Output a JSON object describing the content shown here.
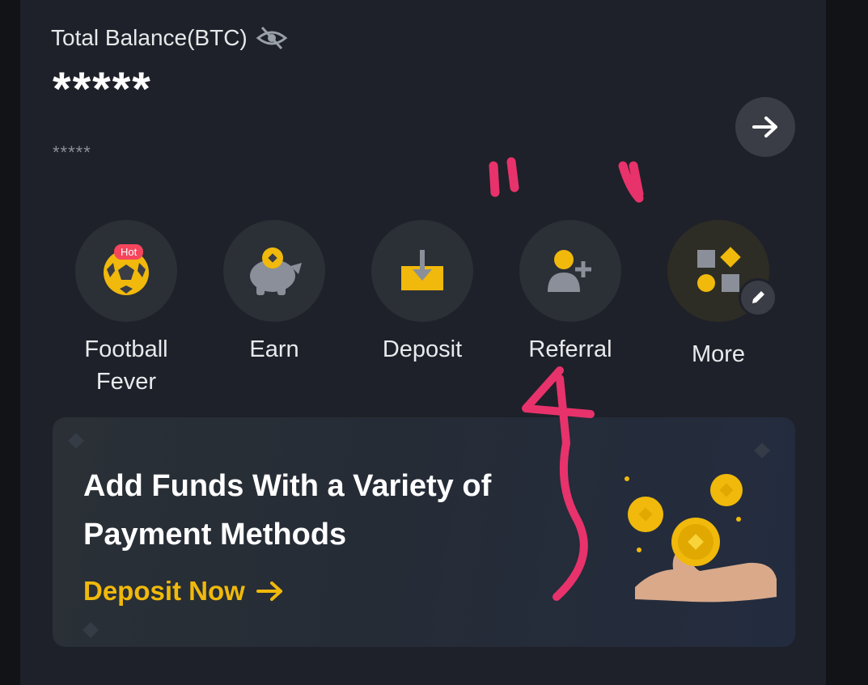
{
  "balance": {
    "label": "Total Balance(BTC)",
    "value": "*****",
    "sub_value": "*****",
    "hide_icon": "eye-slash-icon",
    "arrow_icon": "arrow-right-icon"
  },
  "actions": [
    {
      "label_line1": "Football",
      "label_line2": "Fever",
      "badge": "Hot",
      "icon": "football-icon"
    },
    {
      "label_line1": "Earn",
      "icon": "piggy-bank-icon"
    },
    {
      "label_line1": "Deposit",
      "icon": "deposit-icon"
    },
    {
      "label_line1": "Referral",
      "icon": "add-user-icon"
    },
    {
      "label_line1": "More",
      "icon": "grid-shapes-icon",
      "edit_icon": "pencil-icon"
    }
  ],
  "banner": {
    "title_line1": "Add Funds With a Variety of",
    "title_line2": "Payment Methods",
    "link_label": "Deposit Now",
    "link_icon": "arrow-right-icon",
    "art": "coins-hand-icon"
  },
  "colors": {
    "accent": "#f0b90b",
    "panel": "#1e2129",
    "annotation": "#e8326b",
    "hot_badge": "#f6465d"
  }
}
